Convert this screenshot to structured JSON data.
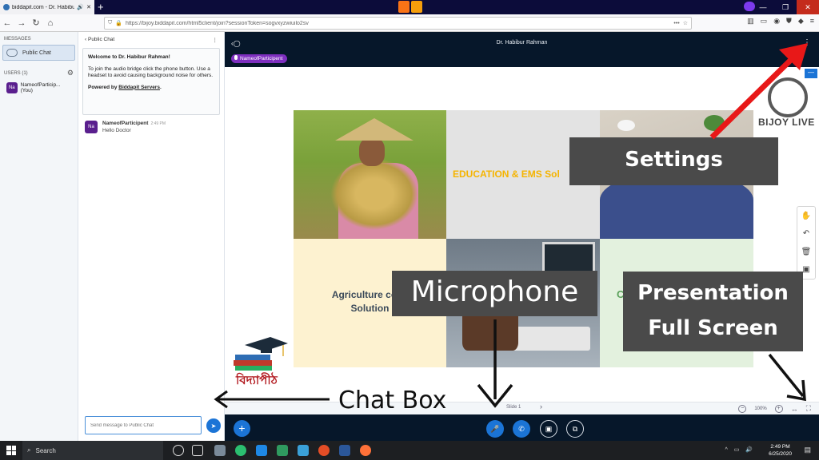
{
  "browser": {
    "tab_title": "biddapit.com - Dr. Habibur",
    "url": "https://bijoy.biddapit.com/html5client/join?sessionToken=sogvxyzwiuilo2sv"
  },
  "sidebar": {
    "messages_label": "MESSAGES",
    "public_chat_label": "Public Chat",
    "users_label": "USERS (1)",
    "users": [
      {
        "initials": "Na",
        "name": "NameofParticip...(You)"
      }
    ]
  },
  "chat": {
    "header": "Public Chat",
    "welcome_title_prefix": "Welcome to ",
    "welcome_title_name": "Dr. Habibur Rahman",
    "welcome_title_suffix": "!",
    "welcome_body": "To join the audio bridge click the phone button. Use a headset to avoid causing background noise for others.",
    "powered_prefix": "Powered by ",
    "powered_link": "Biddapit Servers",
    "powered_suffix": ".",
    "messages": [
      {
        "initials": "Na",
        "sender": "NameofParticipent",
        "time": "2:49 PM",
        "text": "Hello Doctor"
      }
    ],
    "input_placeholder": "Send message to Public Chat"
  },
  "presenter": {
    "name": "Dr. Habibur Rahman",
    "participant_badge": "NameofParticipent"
  },
  "slide": {
    "education_text": "EDUCATION & EMS Sol",
    "agri_line1": "Agriculture cons",
    "agri_line2": "Solution",
    "c_letter": "C",
    "brand": "BIJOY LIVE",
    "slide_label": "Slide 1",
    "zoom": "100%"
  },
  "annotations": {
    "settings": "Settings",
    "microphone": "Microphone",
    "fullscreen_line1": "Presentation",
    "fullscreen_line2": "Full Screen",
    "chatbox": "Chat Box"
  },
  "logo_text": "বিদ্যাপীঠ",
  "taskbar": {
    "search": "Search",
    "time": "2:49 PM",
    "date": "6/25/2020"
  },
  "colors": {
    "accent": "#1b74d6",
    "badge": "#7e2fbf",
    "header_bg": "#06172a",
    "annotation_arrow_red": "#e81818"
  }
}
